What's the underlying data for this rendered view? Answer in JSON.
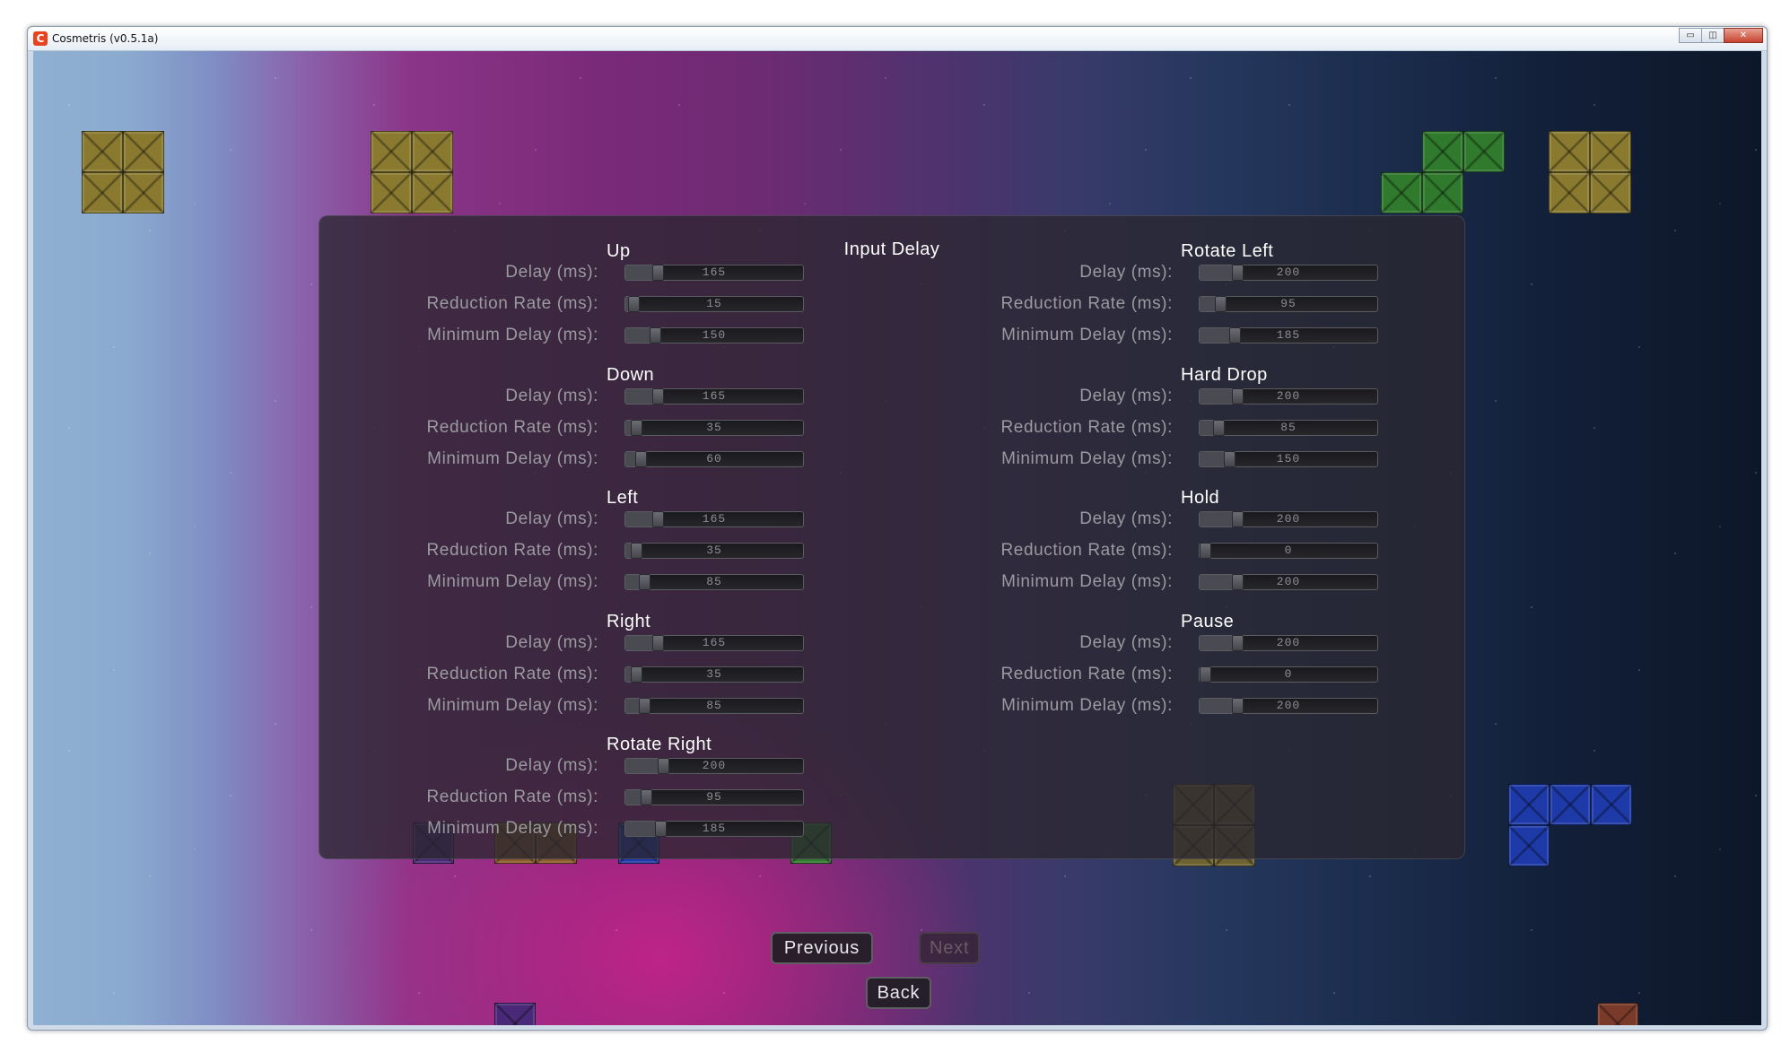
{
  "window": {
    "title": "Cosmetris (v0.5.1a)",
    "icon_glyph": "C",
    "minimize_glyph": "▭",
    "maximize_glyph": "◫",
    "close_glyph": "✕"
  },
  "panel": {
    "title": "Input Delay"
  },
  "labels": {
    "delay": "Delay (ms):",
    "reduction": "Reduction Rate (ms):",
    "minimum": "Minimum Delay (ms):"
  },
  "slider_max": 1000,
  "groups": [
    {
      "id": "up",
      "name": "Up",
      "delay": 165,
      "reduction": 15,
      "minimum": 150
    },
    {
      "id": "down",
      "name": "Down",
      "delay": 165,
      "reduction": 35,
      "minimum": 60
    },
    {
      "id": "left",
      "name": "Left",
      "delay": 165,
      "reduction": 35,
      "minimum": 85
    },
    {
      "id": "right",
      "name": "Right",
      "delay": 165,
      "reduction": 35,
      "minimum": 85
    },
    {
      "id": "rotate-right",
      "name": "Rotate Right",
      "delay": 200,
      "reduction": 95,
      "minimum": 185
    },
    {
      "id": "rotate-left",
      "name": "Rotate Left",
      "delay": 200,
      "reduction": 95,
      "minimum": 185
    },
    {
      "id": "hard-drop",
      "name": "Hard Drop",
      "delay": 200,
      "reduction": 85,
      "minimum": 150
    },
    {
      "id": "hold",
      "name": "Hold",
      "delay": 200,
      "reduction": 0,
      "minimum": 200
    },
    {
      "id": "pause",
      "name": "Pause",
      "delay": 200,
      "reduction": 0,
      "minimum": 200
    }
  ],
  "buttons": {
    "previous": "Previous",
    "next": "Next",
    "back": "Back"
  },
  "colors": {
    "accent_yellow": "#8a7a30",
    "accent_green": "#2f7a2c",
    "accent_blue": "#1d3aa8",
    "accent_red": "#7a2a2a",
    "accent_purple": "#4a2a78",
    "accent_orange": "#8a5a2a"
  }
}
